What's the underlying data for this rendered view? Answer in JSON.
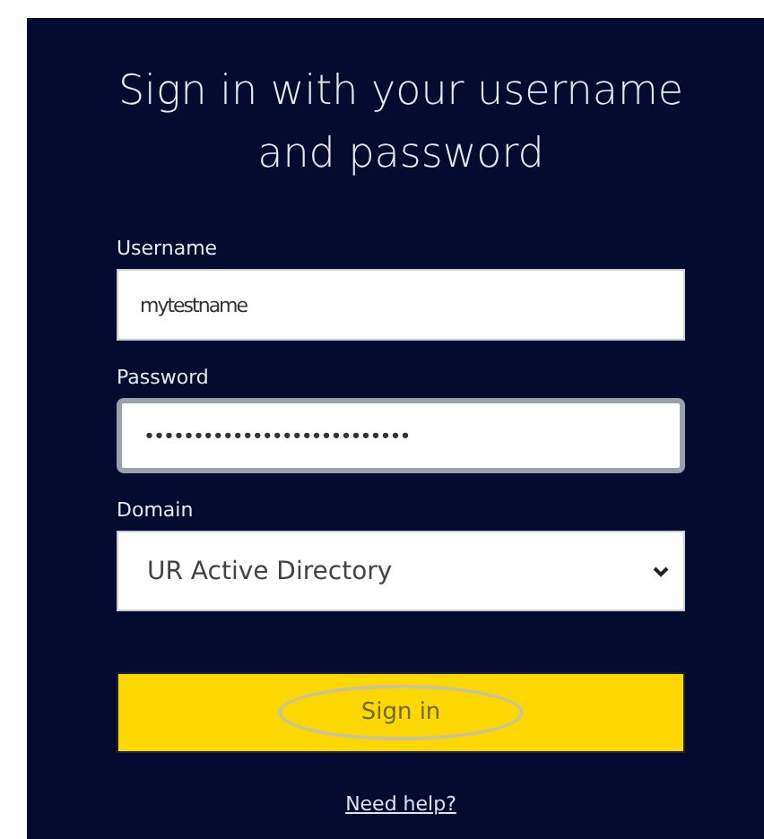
{
  "title": "Sign in with your username and password",
  "fields": [
    {
      "kind": "text",
      "label": "Username",
      "value": "mytestname",
      "focused": false
    },
    {
      "kind": "text",
      "label": "Password",
      "value": "•••••••••••••••••••••••••••",
      "focused": true
    },
    {
      "kind": "select",
      "label": "Domain",
      "value": "UR Active Directory"
    }
  ],
  "submit": {
    "label": "Sign in",
    "highlighted": true
  },
  "help_link": "Need help?"
}
